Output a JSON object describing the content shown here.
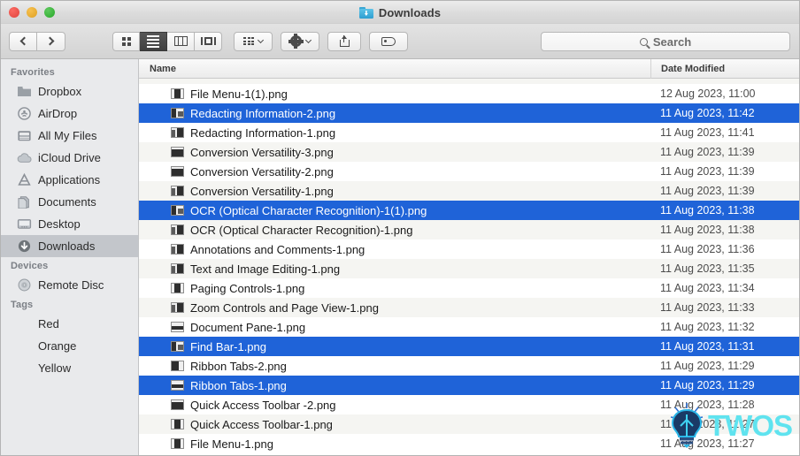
{
  "window": {
    "title": "Downloads",
    "title_icon": "blue-folder-downloads-icon",
    "traffic_lights": [
      {
        "name": "close-button",
        "color": "#e0443e"
      },
      {
        "name": "minimize-button",
        "color": "#dea123"
      },
      {
        "name": "zoom-button",
        "color": "#28a828"
      }
    ]
  },
  "toolbar": {
    "back_label": "Back",
    "forward_label": "Forward",
    "view_modes": [
      {
        "name": "icon-view",
        "label": "Icon View",
        "active": false
      },
      {
        "name": "list-view",
        "label": "List View",
        "active": true
      },
      {
        "name": "column-view",
        "label": "Column View",
        "active": false
      },
      {
        "name": "gallery-view",
        "label": "Cover Flow View",
        "active": false
      }
    ],
    "arrange_label": "Arrange",
    "action_label": "Action",
    "share_label": "Share",
    "tag_label": "Edit Tags"
  },
  "search": {
    "placeholder": "Search",
    "value": ""
  },
  "sidebar": {
    "sections": [
      {
        "header": "Favorites",
        "items": [
          {
            "label": "Dropbox",
            "icon": "folder-icon",
            "selected": false
          },
          {
            "label": "AirDrop",
            "icon": "airdrop-icon",
            "selected": false
          },
          {
            "label": "All My Files",
            "icon": "all-my-files-icon",
            "selected": false
          },
          {
            "label": "iCloud Drive",
            "icon": "icloud-icon",
            "selected": false
          },
          {
            "label": "Applications",
            "icon": "applications-icon",
            "selected": false
          },
          {
            "label": "Documents",
            "icon": "documents-icon",
            "selected": false
          },
          {
            "label": "Desktop",
            "icon": "desktop-icon",
            "selected": false
          },
          {
            "label": "Downloads",
            "icon": "downloads-icon",
            "selected": true
          }
        ]
      },
      {
        "header": "Devices",
        "items": [
          {
            "label": "Remote Disc",
            "icon": "disc-icon",
            "selected": false
          }
        ]
      },
      {
        "header": "Tags",
        "items": [
          {
            "label": "Red",
            "icon": "tag-dot-icon",
            "color": "#f25a57",
            "selected": false
          },
          {
            "label": "Orange",
            "icon": "tag-dot-icon",
            "color": "#f4a02c",
            "selected": false
          },
          {
            "label": "Yellow",
            "icon": "tag-dot-icon",
            "color": "#f2cf2e",
            "selected": false
          }
        ]
      }
    ]
  },
  "file_list": {
    "columns": [
      {
        "key": "name",
        "label": "Name",
        "sorted": true
      },
      {
        "key": "date",
        "label": "Date Modified",
        "sorted": false
      }
    ],
    "partial_row_top": {
      "name": "",
      "date": ""
    },
    "rows": [
      {
        "name": "File Menu-1(1).png",
        "date": "12 Aug 2023, 11:00",
        "selected": false,
        "thumb": "dark-center"
      },
      {
        "name": "Redacting Information-2.png",
        "date": "11 Aug 2023, 11:42",
        "selected": true,
        "thumb": "left-block"
      },
      {
        "name": "Redacting Information-1.png",
        "date": "11 Aug 2023, 11:41",
        "selected": false,
        "thumb": "right-block"
      },
      {
        "name": "Conversion Versatility-3.png",
        "date": "11 Aug 2023, 11:39",
        "selected": false,
        "thumb": "solid-bar"
      },
      {
        "name": "Conversion Versatility-2.png",
        "date": "11 Aug 2023, 11:39",
        "selected": false,
        "thumb": "solid-bar"
      },
      {
        "name": "Conversion Versatility-1.png",
        "date": "11 Aug 2023, 11:39",
        "selected": false,
        "thumb": "right-block"
      },
      {
        "name": "OCR (Optical Character Recognition)-1(1).png",
        "date": "11 Aug 2023, 11:38",
        "selected": true,
        "thumb": "left-block"
      },
      {
        "name": "OCR (Optical Character Recognition)-1.png",
        "date": "11 Aug 2023, 11:38",
        "selected": false,
        "thumb": "right-block"
      },
      {
        "name": "Annotations and Comments-1.png",
        "date": "11 Aug 2023, 11:36",
        "selected": false,
        "thumb": "right-block"
      },
      {
        "name": "Text and Image Editing-1.png",
        "date": "11 Aug 2023, 11:35",
        "selected": false,
        "thumb": "right-block"
      },
      {
        "name": "Paging Controls-1.png",
        "date": "11 Aug 2023, 11:34",
        "selected": false,
        "thumb": "dark-center"
      },
      {
        "name": "Zoom Controls and Page View-1.png",
        "date": "11 Aug 2023, 11:33",
        "selected": false,
        "thumb": "right-block"
      },
      {
        "name": "Document Pane-1.png",
        "date": "11 Aug 2023, 11:32",
        "selected": false,
        "thumb": "thin-bar"
      },
      {
        "name": "Find Bar-1.png",
        "date": "11 Aug 2023, 11:31",
        "selected": true,
        "thumb": "left-block"
      },
      {
        "name": "Ribbon Tabs-2.png",
        "date": "11 Aug 2023, 11:29",
        "selected": false,
        "thumb": "dark-left"
      },
      {
        "name": "Ribbon Tabs-1.png",
        "date": "11 Aug 2023, 11:29",
        "selected": true,
        "thumb": "thin-bar"
      },
      {
        "name": "Quick Access Toolbar -2.png",
        "date": "11 Aug 2023, 11:28",
        "selected": false,
        "thumb": "solid-bar"
      },
      {
        "name": "Quick Access Toolbar-1.png",
        "date": "11 Aug 2023, 11:27",
        "selected": false,
        "thumb": "dark-center"
      },
      {
        "name": "File Menu-1.png",
        "date": "11 Aug 2023, 11:27",
        "selected": false,
        "thumb": "dark-center"
      }
    ]
  },
  "watermark": {
    "text": "TWOS",
    "color": "#5fe3ef",
    "logo": "lightbulb-icon"
  }
}
